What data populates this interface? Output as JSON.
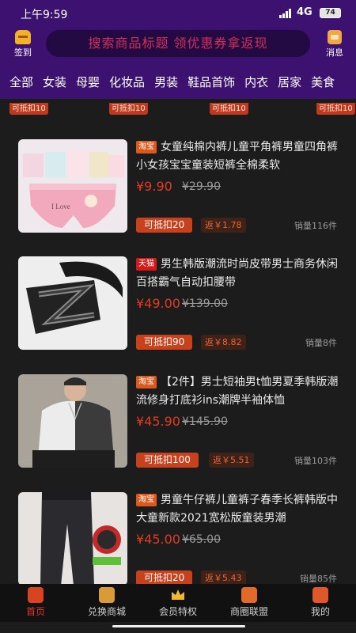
{
  "status_bar": {
    "time": "上午9:59",
    "network": "4G",
    "battery": "74"
  },
  "header": {
    "signin_label": "签到",
    "search_placeholder": "搜索商品标题 领优惠券拿返现",
    "message_label": "消息"
  },
  "categories": [
    "全部",
    "女装",
    "母婴",
    "化妆品",
    "男装",
    "鞋品首饰",
    "内衣",
    "居家",
    "美食"
  ],
  "strip_tags": [
    "可抵扣10",
    "可抵扣10",
    "可抵扣10",
    "可抵扣10"
  ],
  "products": [
    {
      "source": "淘宝",
      "title": "女童纯棉内裤儿童平角裤男童四角裤小女孩宝宝童装短裤全棉柔软",
      "price": "¥9.90",
      "original_price": "¥29.90",
      "deduct": "可抵扣20",
      "rebate": "返￥1.78",
      "sold": "销量116件"
    },
    {
      "source": "天猫",
      "title": "男生韩版潮流时尚皮带男士商务休闲百搭霸气自动扣腰带",
      "price": "¥49.00",
      "original_price": "¥139.00",
      "deduct": "可抵扣90",
      "rebate": "返￥8.82",
      "sold": "销量8件"
    },
    {
      "source": "淘宝",
      "title": "【2件】男士短袖男t恤男夏季韩版潮流修身打底衫ins潮牌半袖体恤",
      "price": "¥45.90",
      "original_price": "¥145.90",
      "deduct": "可抵扣100",
      "rebate": "返￥5.51",
      "sold": "销量103件"
    },
    {
      "source": "淘宝",
      "title": "男童牛仔裤儿童裤子春季长裤韩版中大童新款2021宽松版童装男潮",
      "price": "¥45.00",
      "original_price": "¥65.00",
      "deduct": "可抵扣20",
      "rebate": "返￥5.43",
      "sold": "销量85件"
    }
  ],
  "tabbar": [
    "首页",
    "兑换商城",
    "会员特权",
    "商圈联盟",
    "我的"
  ],
  "colors": {
    "accent": "#e03a2a",
    "header_bg": "#3d1170",
    "page_bg": "#1c1c1c"
  }
}
